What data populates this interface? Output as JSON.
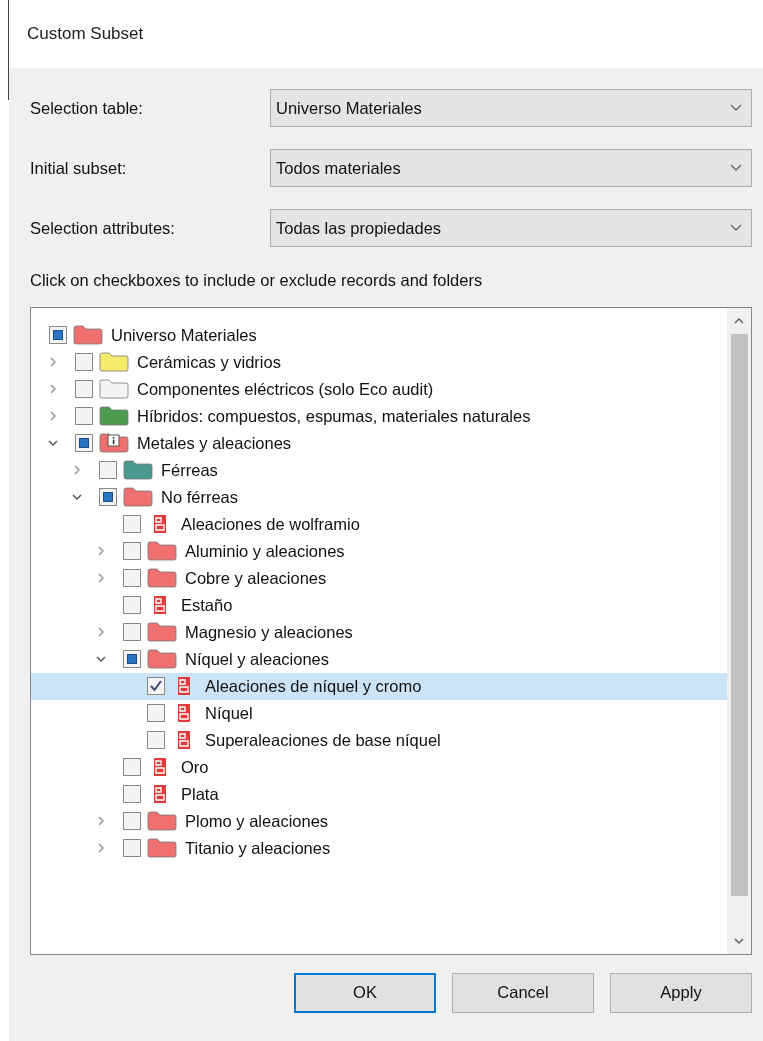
{
  "window": {
    "title": "Custom Subset"
  },
  "fields": [
    {
      "label": "Selection table:",
      "value": "Universo Materiales"
    },
    {
      "label": "Initial subset:",
      "value": "Todos materiales"
    },
    {
      "label": "Selection attributes:",
      "value": "Todas las propiedades"
    }
  ],
  "instruction": "Click on checkboxes to include or exclude records and folders",
  "tree": {
    "items": [
      {
        "label": "Universo Materiales",
        "kind": "folder",
        "color": "#f07070",
        "checked": false,
        "partial": true,
        "selected": false,
        "children": [
          {
            "label": "Cerámicas y vidrios",
            "kind": "folder",
            "color": "#f5ec6e",
            "checked": false,
            "partial": false,
            "expanded": false,
            "selected": false
          },
          {
            "label": "Componentes eléctricos (solo Eco audit)",
            "kind": "folder",
            "color": "#f4f4f4",
            "checked": false,
            "partial": false,
            "expanded": false,
            "selected": false
          },
          {
            "label": "Híbridos: compuestos, espumas, materiales naturales",
            "kind": "folder",
            "color": "#4e9a4e",
            "checked": false,
            "partial": false,
            "expanded": false,
            "selected": false
          },
          {
            "label": "Metales y aleaciones",
            "kind": "info-folder",
            "color": "#f07070",
            "checked": false,
            "partial": true,
            "expanded": true,
            "selected": false,
            "children": [
              {
                "label": "Férreas",
                "kind": "folder",
                "color": "#4a9a90",
                "checked": false,
                "partial": false,
                "expanded": false,
                "selected": false
              },
              {
                "label": "No férreas",
                "kind": "folder",
                "color": "#f07070",
                "checked": false,
                "partial": true,
                "expanded": true,
                "selected": false,
                "children": [
                  {
                    "label": "Aleaciones de wolframio",
                    "kind": "record",
                    "checked": false,
                    "partial": false,
                    "selected": false
                  },
                  {
                    "label": "Aluminio y aleaciones",
                    "kind": "folder",
                    "color": "#f07070",
                    "checked": false,
                    "partial": false,
                    "expanded": false,
                    "selected": false
                  },
                  {
                    "label": "Cobre y aleaciones",
                    "kind": "folder",
                    "color": "#f07070",
                    "checked": false,
                    "partial": false,
                    "expanded": false,
                    "selected": false
                  },
                  {
                    "label": "Estaño",
                    "kind": "record",
                    "checked": false,
                    "partial": false,
                    "selected": false
                  },
                  {
                    "label": "Magnesio y aleaciones",
                    "kind": "folder",
                    "color": "#f07070",
                    "checked": false,
                    "partial": false,
                    "expanded": false,
                    "selected": false
                  },
                  {
                    "label": "Níquel y aleaciones",
                    "kind": "folder",
                    "color": "#f07070",
                    "checked": false,
                    "partial": true,
                    "expanded": true,
                    "selected": false,
                    "children": [
                      {
                        "label": "Aleaciones de níquel y cromo",
                        "kind": "record",
                        "checked": true,
                        "partial": false,
                        "selected": true
                      },
                      {
                        "label": "Níquel",
                        "kind": "record",
                        "checked": false,
                        "partial": false,
                        "selected": false
                      },
                      {
                        "label": "Superaleaciones de base níquel",
                        "kind": "record",
                        "checked": false,
                        "partial": false,
                        "selected": false
                      }
                    ]
                  },
                  {
                    "label": "Oro",
                    "kind": "record",
                    "checked": false,
                    "partial": false,
                    "selected": false
                  },
                  {
                    "label": "Plata",
                    "kind": "record",
                    "checked": false,
                    "partial": false,
                    "selected": false
                  },
                  {
                    "label": "Plomo y aleaciones",
                    "kind": "folder",
                    "color": "#f07070",
                    "checked": false,
                    "partial": false,
                    "expanded": false,
                    "selected": false
                  },
                  {
                    "label": "Titanio y aleaciones",
                    "kind": "folder",
                    "color": "#f07070",
                    "checked": false,
                    "partial": false,
                    "expanded": false,
                    "selected": false
                  }
                ]
              }
            ]
          }
        ]
      }
    ]
  },
  "buttons": [
    {
      "label": "OK",
      "default": true
    },
    {
      "label": "Cancel",
      "default": false
    },
    {
      "label": "Apply",
      "default": false
    }
  ]
}
